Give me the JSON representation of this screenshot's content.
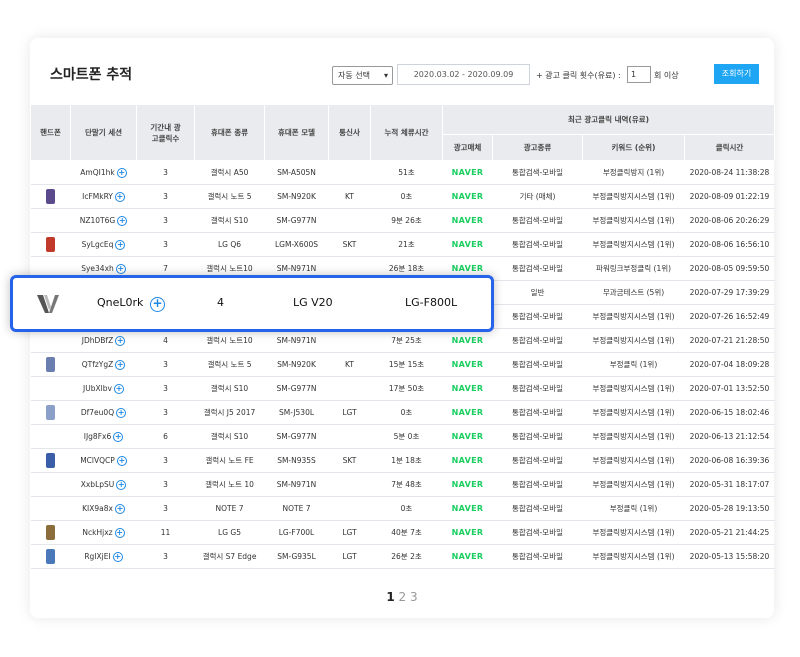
{
  "header": {
    "title": "스마트폰 추적",
    "auto_select": "자동 선택",
    "date_range": "2020.03.02 - 2020.09.09",
    "click_label": "+ 광고 클릭 횟수(유료) :",
    "click_value": "1",
    "click_suffix": "회 이상",
    "search_button": "조회하기"
  },
  "table": {
    "headers": {
      "phone": "핸드폰",
      "session": "단말기 세션",
      "period_clicks": "기간내 광고클릭수",
      "phone_type": "휴대폰 종류",
      "phone_model": "휴대폰 모델",
      "carrier": "통신사",
      "dwell": "누적 체류시간",
      "recent_group": "최근 광고클릭 내역(유료)",
      "ad_media": "광고매체",
      "ad_type": "광고종류",
      "keyword": "키워드 (순위)",
      "click_time": "클릭시간"
    },
    "rows": [
      {
        "phone": "",
        "phone_color": "",
        "session": "AmQI1hk",
        "count": "3",
        "type": "갤럭시 A50",
        "model": "SM-A505N",
        "carrier": "",
        "dwell": "51초",
        "media": "NAVER",
        "ad_type": "통합검색-모바일",
        "keyword": "부정클릭방지 (1위)",
        "time": "2020-08-24 11:38:28"
      },
      {
        "phone": "galaxy-phone",
        "phone_color": "#5b4a8c",
        "session": "IcFMkRY",
        "count": "3",
        "type": "갤럭시 노트 5",
        "model": "SM-N920K",
        "carrier": "KT",
        "dwell": "0초",
        "media": "NAVER",
        "ad_type": "기타 (매체)",
        "keyword": "부정클릭방지시스템 (1위)",
        "time": "2020-08-09 01:22:19"
      },
      {
        "phone": "",
        "phone_color": "",
        "session": "NZ10T6G",
        "count": "3",
        "type": "갤럭시 S10",
        "model": "SM-G977N",
        "carrier": "",
        "dwell": "9분 26초",
        "media": "NAVER",
        "ad_type": "통합검색-모바일",
        "keyword": "부정클릭방지시스템 (1위)",
        "time": "2020-08-06 20:26:29"
      },
      {
        "phone": "lg-phone",
        "phone_color": "#c0392b",
        "session": "SyLgcEq",
        "count": "3",
        "type": "LG Q6",
        "model": "LGM-X600S",
        "carrier": "SKT",
        "dwell": "21초",
        "media": "NAVER",
        "ad_type": "통합검색-모바일",
        "keyword": "부정클릭방지시스템 (1위)",
        "time": "2020-08-06 16:56:10"
      },
      {
        "phone": "",
        "phone_color": "",
        "session": "Sye34xh",
        "count": "7",
        "type": "갤럭시 노트10",
        "model": "SM-N971N",
        "carrier": "",
        "dwell": "26분 18초",
        "media": "NAVER",
        "ad_type": "통합검색-모바일",
        "keyword": "파워링크부정클릭 (1위)",
        "time": "2020-08-05 09:59:50"
      },
      {
        "phone": "",
        "phone_color": "",
        "session": "",
        "count": "",
        "type": "",
        "model": "",
        "carrier": "",
        "dwell": "",
        "media": "",
        "ad_type": "일반",
        "keyword": "무과금테스트 (5위)",
        "time": "2020-07-29 17:39:29"
      },
      {
        "phone": "",
        "phone_color": "",
        "session": "",
        "count": "",
        "type": "",
        "model": "",
        "carrier": "",
        "dwell": "",
        "media": "NAVER",
        "ad_type": "통합검색-모바일",
        "keyword": "부정클릭방지시스템 (1위)",
        "time": "2020-07-26 16:52:49"
      },
      {
        "phone": "",
        "phone_color": "",
        "session": "JDhDBfZ",
        "count": "4",
        "type": "갤럭시 노트10",
        "model": "SM-N971N",
        "carrier": "",
        "dwell": "7분 25초",
        "media": "NAVER",
        "ad_type": "통합검색-모바일",
        "keyword": "부정클릭방지시스템 (1위)",
        "time": "2020-07-21 21:28:50"
      },
      {
        "phone": "galaxy-phone",
        "phone_color": "#6a7fb0",
        "session": "QTfzYgZ",
        "count": "3",
        "type": "갤럭시 노트 5",
        "model": "SM-N920K",
        "carrier": "KT",
        "dwell": "15분 15초",
        "media": "NAVER",
        "ad_type": "통합검색-모바일",
        "keyword": "부정클릭 (1위)",
        "time": "2020-07-04 18:09:28"
      },
      {
        "phone": "",
        "phone_color": "",
        "session": "JUbXlbv",
        "count": "3",
        "type": "갤럭시 S10",
        "model": "SM-G977N",
        "carrier": "",
        "dwell": "17분 50초",
        "media": "NAVER",
        "ad_type": "통합검색-모바일",
        "keyword": "부정클릭방지시스템 (1위)",
        "time": "2020-07-01 13:52:50"
      },
      {
        "phone": "galaxy-phone",
        "phone_color": "#8aa0c8",
        "session": "Df7eu0Q",
        "count": "3",
        "type": "갤럭시 J5 2017",
        "model": "SM-J530L",
        "carrier": "LGT",
        "dwell": "0초",
        "media": "NAVER",
        "ad_type": "통합검색-모바일",
        "keyword": "부정클릭방지시스템 (1위)",
        "time": "2020-06-15 18:02:46"
      },
      {
        "phone": "",
        "phone_color": "",
        "session": "IJg8Fx6",
        "count": "6",
        "type": "갤럭시 S10",
        "model": "SM-G977N",
        "carrier": "",
        "dwell": "5분 0초",
        "media": "NAVER",
        "ad_type": "통합검색-모바일",
        "keyword": "부정클릭방지시스템 (1위)",
        "time": "2020-06-13 21:12:54"
      },
      {
        "phone": "galaxy-phone",
        "phone_color": "#3a5fa8",
        "session": "MClVQCP",
        "count": "3",
        "type": "갤럭시 노트 FE",
        "model": "SM-N935S",
        "carrier": "SKT",
        "dwell": "1분 18초",
        "media": "NAVER",
        "ad_type": "통합검색-모바일",
        "keyword": "부정클릭방지시스템 (1위)",
        "time": "2020-06-08 16:39:36"
      },
      {
        "phone": "",
        "phone_color": "",
        "session": "XxbLpSU",
        "count": "3",
        "type": "갤럭시 노트 10",
        "model": "SM-N971N",
        "carrier": "",
        "dwell": "7분 48초",
        "media": "NAVER",
        "ad_type": "통합검색-모바일",
        "keyword": "부정클릭방지시스템 (1위)",
        "time": "2020-05-31 18:17:07"
      },
      {
        "phone": "",
        "phone_color": "",
        "session": "KIX9a8x",
        "count": "3",
        "type": "NOTE 7",
        "model": "NOTE 7",
        "carrier": "",
        "dwell": "0초",
        "media": "NAVER",
        "ad_type": "통합검색-모바일",
        "keyword": "부정클릭 (1위)",
        "time": "2020-05-28 19:13:50"
      },
      {
        "phone": "lg-phone",
        "phone_color": "#8a6d3b",
        "session": "NckHjxz",
        "count": "11",
        "type": "LG G5",
        "model": "LG-F700L",
        "carrier": "LGT",
        "dwell": "40분 7초",
        "media": "NAVER",
        "ad_type": "통합검색-모바일",
        "keyword": "부정클릭방지시스템 (1위)",
        "time": "2020-05-21 21:44:25"
      },
      {
        "phone": "galaxy-phone",
        "phone_color": "#4a78b8",
        "session": "RgIXjEI",
        "count": "3",
        "type": "갤럭시 S7 Edge",
        "model": "SM-G935L",
        "carrier": "LGT",
        "dwell": "26분 2초",
        "media": "NAVER",
        "ad_type": "통합검색-모바일",
        "keyword": "부정클릭방지시스템 (1위)",
        "time": "2020-05-13 15:58:20"
      }
    ]
  },
  "pagination": {
    "pages": [
      "1",
      "2",
      "3"
    ],
    "current": "1"
  },
  "highlight": {
    "session": "QneL0rk",
    "count": "4",
    "type": "LG V20",
    "model": "LG-F800L",
    "icon": "lg-v20-phone-icon"
  },
  "colors": {
    "accent": "#1ea6f4",
    "naver": "#19ce60",
    "highlight_border": "#2563eb"
  }
}
